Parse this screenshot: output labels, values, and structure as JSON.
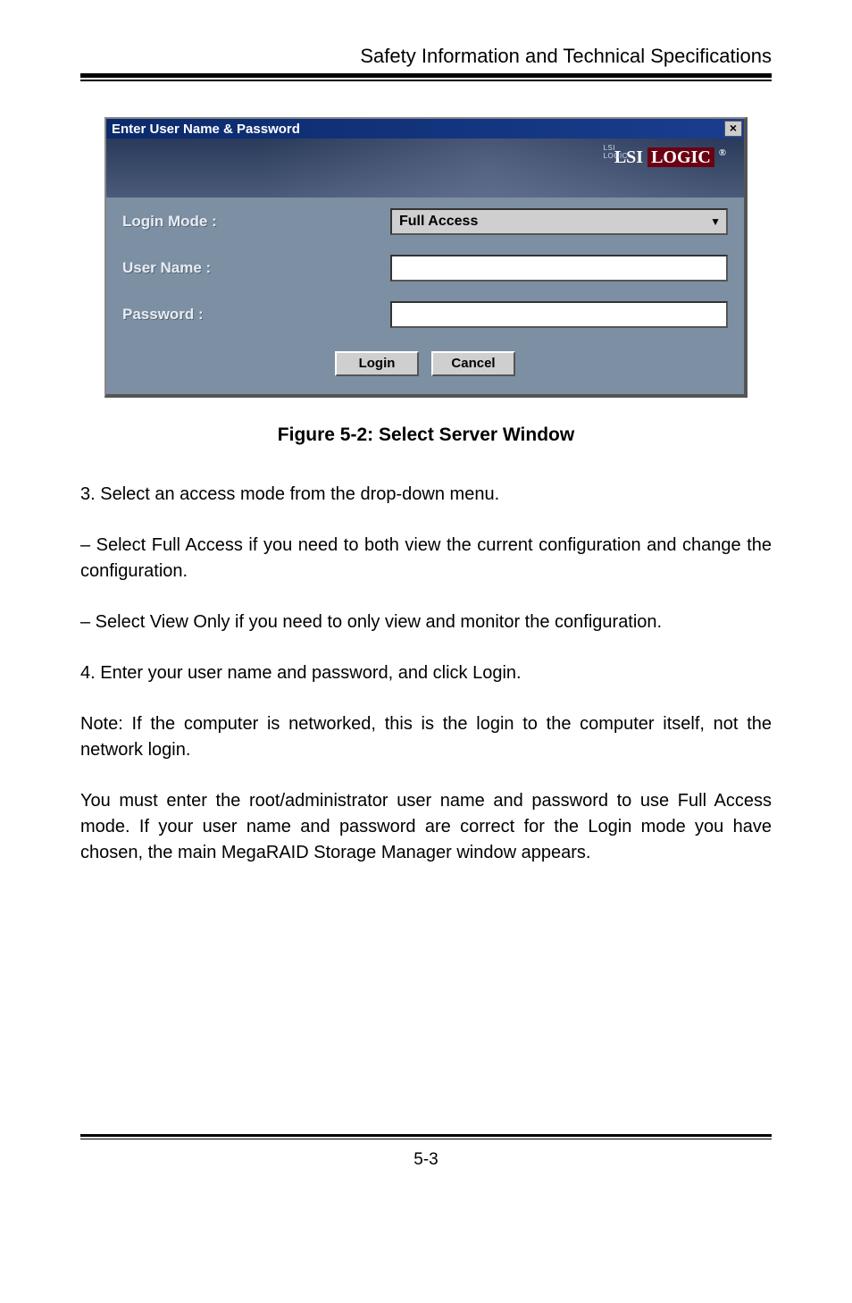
{
  "page": {
    "header": "Safety Information and Technical Specifications",
    "footer_page": "5-3"
  },
  "dialog": {
    "title": "Enter User Name & Password",
    "close_symbol": "×",
    "brand_text1": "LSI",
    "brand_text2": "LOGIC",
    "brand_reg": "®",
    "brand_tag": "LSI LOGIC",
    "labels": {
      "login_mode": "Login Mode :",
      "user_name": "User Name :",
      "password": "Password :"
    },
    "login_mode_value": "Full Access",
    "user_name_value": "",
    "password_value": "",
    "buttons": {
      "login": "Login",
      "cancel": "Cancel"
    }
  },
  "caption": "Figure 5-2: Select Server Window",
  "body": {
    "p1": "3. Select an access mode from the drop-down menu.",
    "p2": "– Select Full Access if you need to both view the current configuration and change the configuration.",
    "p3": "– Select View Only if you need to only view and monitor the configuration.",
    "p4": "4. Enter your user name and password, and click Login.",
    "p5": "Note: If the computer is networked, this is the login to the computer itself, not the network login.",
    "p6": "You must enter the root/administrator user name and password to use Full Access mode. If your user name and password are correct for the Login mode you have chosen, the main MegaRAID Storage Manager window appears."
  }
}
